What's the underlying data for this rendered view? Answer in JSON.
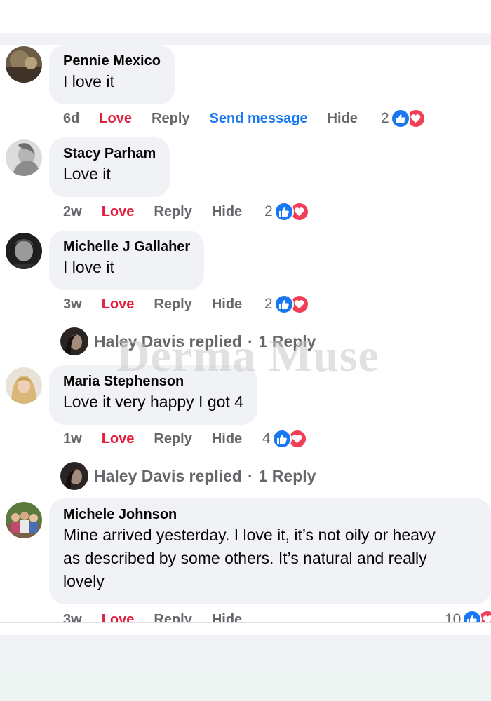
{
  "watermark": "Derma Muse",
  "colors": {
    "love": "#e41e3f",
    "link": "#1877f2",
    "muted": "#65676b",
    "bubble": "#f0f2f5",
    "like": "#1877f2",
    "heart": "#f33e58"
  },
  "comments": [
    {
      "author": "Pennie Mexico",
      "text": "I love it",
      "time": "6d",
      "love_label": "Love",
      "reply_label": "Reply",
      "send_label": "Send message",
      "hide_label": "Hide",
      "reaction_count": "2",
      "reactions": [
        "like-icon",
        "heart-icon"
      ]
    },
    {
      "author": "Stacy Parham",
      "text": "Love it",
      "time": "2w",
      "love_label": "Love",
      "reply_label": "Reply",
      "hide_label": "Hide",
      "reaction_count": "2",
      "reactions": [
        "like-icon",
        "heart-icon"
      ]
    },
    {
      "author": "Michelle J Gallaher",
      "text": "I love it",
      "time": "3w",
      "love_label": "Love",
      "reply_label": "Reply",
      "hide_label": "Hide",
      "reaction_count": "2",
      "reactions": [
        "like-icon",
        "heart-icon"
      ],
      "replies": {
        "name": "Haley Davis",
        "verb": "replied",
        "sep": "·",
        "count": "1 Reply"
      }
    },
    {
      "author": "Maria Stephenson",
      "text": "Love it very happy I got 4",
      "time": "1w",
      "love_label": "Love",
      "reply_label": "Reply",
      "hide_label": "Hide",
      "reaction_count": "4",
      "reactions": [
        "like-icon",
        "heart-icon"
      ],
      "replies": {
        "name": "Haley Davis",
        "verb": "replied",
        "sep": "·",
        "count": "1 Reply"
      }
    },
    {
      "author": "Michele Johnson",
      "text_lines": [
        "Mine arrived yesterday. I love it, it’s not oily or heavy",
        "as described by some others. It’s natural and really",
        "lovely"
      ],
      "time": "3w",
      "love_label": "Love",
      "reply_label": "Reply",
      "hide_label": "Hide",
      "reaction_count": "10",
      "reactions": [
        "like-icon",
        "heart-icon"
      ]
    }
  ]
}
